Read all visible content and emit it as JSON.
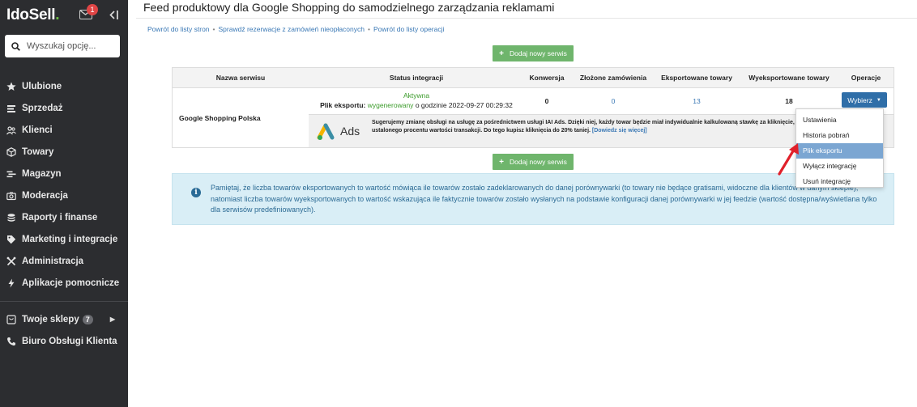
{
  "sidebar": {
    "logo_main": "IdoSell",
    "logo_dot": ".",
    "mail_badge": "1",
    "search_placeholder": "Wyszukaj opcję...",
    "items": [
      {
        "label": "Ulubione",
        "icon": "star-icon"
      },
      {
        "label": "Sprzedaż",
        "icon": "sales-icon"
      },
      {
        "label": "Klienci",
        "icon": "users-icon"
      },
      {
        "label": "Towary",
        "icon": "box-icon"
      },
      {
        "label": "Magazyn",
        "icon": "warehouse-icon"
      },
      {
        "label": "Moderacja",
        "icon": "camera-icon"
      },
      {
        "label": "Raporty i finanse",
        "icon": "coins-icon"
      },
      {
        "label": "Marketing i integracje",
        "icon": "tag-icon"
      },
      {
        "label": "Administracja",
        "icon": "tools-icon"
      },
      {
        "label": "Aplikacje pomocnicze",
        "icon": "bolt-icon"
      }
    ],
    "bottom_items": [
      {
        "label": "Twoje sklepy",
        "badge": "7",
        "icon": "store-icon"
      },
      {
        "label": "Biuro Obsługi Klienta",
        "icon": "phone-icon"
      }
    ]
  },
  "header": {
    "title": "Feed produktowy dla Google Shopping do samodzielnego zarządzania reklamami"
  },
  "breadcrumbs": [
    "Powrót do listy stron",
    "Sprawdź rezerwacje z zamówień nieopłaconych",
    "Powrót do listy operacji"
  ],
  "add_button_label": "Dodaj nowy serwis",
  "table": {
    "headers": [
      "Nazwa serwisu",
      "Status integracji",
      "Konwersja",
      "Złożone zamówienia",
      "Eksportowane towary",
      "Wyeksportowane towary",
      "Operacje"
    ],
    "row": {
      "name": "Google Shopping Polska",
      "status": "Aktywna",
      "export_label": "Plik eksportu:",
      "export_state": "wygenerowany",
      "export_time": "o godzinie 2022-09-27 00:29:32",
      "conversion": "0",
      "orders": "0",
      "exported": "13",
      "exported_done": "18",
      "select_label": "Wybierz"
    },
    "ads": {
      "logo_text": "Ads",
      "text_line1": "Sugerujemy zmianę obsługi na usługę za pośrednictwem usługi IAI Ads. Dzięki niej, każdy towar będzie miał indywidualnie kalkulowaną stawkę za kliknięcie, w oparciu o",
      "text_line2": "ustalonego procentu wartości transakcji. Do tego kupisz kliknięcia do 20% taniej.",
      "more": "[Dowiedz się więcej]"
    }
  },
  "dropdown": {
    "items": [
      "Ustawienia",
      "Historia pobrań",
      "Plik eksportu",
      "Wyłącz integrację",
      "Usuń integrację"
    ],
    "active_index": 2
  },
  "info": {
    "text": "Pamiętaj, że liczba towarów eksportowanych to wartość mówiąca ile towarów zostało zadeklarowanych do danej porównywarki (to towary nie będące gratisami, widoczne dla klientów w danym sklepie), natomiast liczba towarów wyeksportowanych to wartość wskazująca ile faktycznie towarów zostało wysłanych na podstawie konfiguracji danej porównywarki w jej feedzie (wartość dostępna/wyświetlana tylko dla serwisów predefiniowanych)."
  },
  "colors": {
    "sidebar_bg": "#2c2d30",
    "accent_green": "#6fb56c",
    "primary_blue": "#2f6ea8",
    "link_blue": "#3a78b5",
    "active_green": "#3b9b2a",
    "info_bg": "#d9eef6",
    "arrow_red": "#e0202a"
  }
}
